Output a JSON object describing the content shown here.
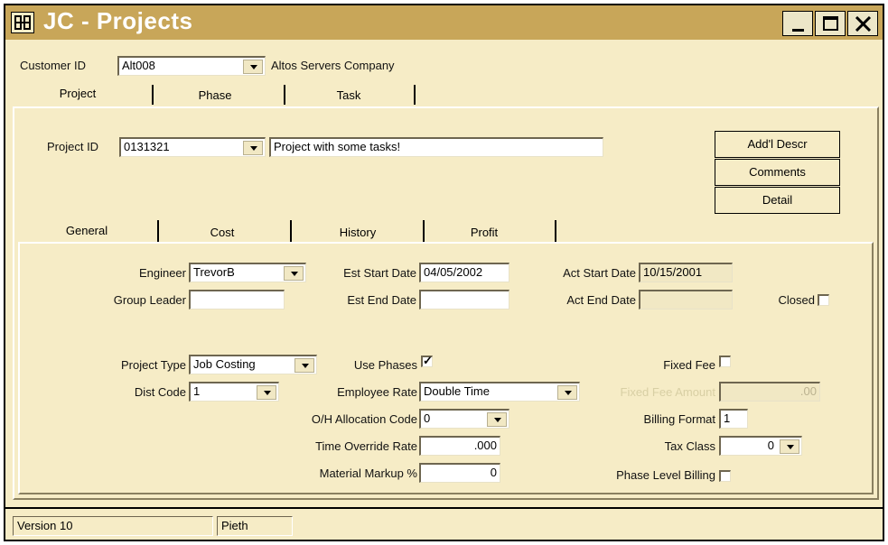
{
  "window": {
    "title": "JC - Projects",
    "minimize_label": "_",
    "maximize_label": "☐",
    "close_label": "✕"
  },
  "customer": {
    "label": "Customer ID",
    "id_value": "Alt008",
    "company_name": "Altos Servers Company"
  },
  "main_tabs": [
    "Project",
    "Phase",
    "Task"
  ],
  "project": {
    "id_label": "Project ID",
    "id_value": "0131321",
    "description": "Project with some tasks!"
  },
  "side_buttons": [
    "Add'l Descr",
    "Comments",
    "Detail"
  ],
  "sub_tabs": [
    "General",
    "Cost",
    "History",
    "Profit"
  ],
  "general": {
    "engineer_label": "Engineer",
    "engineer_value": "TrevorB",
    "group_leader_label": "Group Leader",
    "group_leader_value": "",
    "est_start_label": "Est Start Date",
    "est_start_value": "04/05/2002",
    "est_end_label": "Est End Date",
    "est_end_value": "",
    "act_start_label": "Act Start Date",
    "act_start_value": "10/15/2001",
    "act_end_label": "Act End Date",
    "act_end_value": "",
    "closed_label": "Closed",
    "closed_checked": false,
    "project_type_label": "Project Type",
    "project_type_value": "Job Costing",
    "use_phases_label": "Use Phases",
    "use_phases_checked": true,
    "fixed_fee_label": "Fixed Fee",
    "fixed_fee_checked": false,
    "dist_code_label": "Dist Code",
    "dist_code_value": "1",
    "employee_rate_label": "Employee Rate",
    "employee_rate_value": "Double Time",
    "fixed_fee_amount_label": "Fixed Fee Amount",
    "fixed_fee_amount_value": ".00",
    "oh_alloc_label": "O/H Allocation Code",
    "oh_alloc_value": "0",
    "billing_format_label": "Billing Format",
    "billing_format_value": "1",
    "time_override_label": "Time Override Rate",
    "time_override_value": ".000",
    "tax_class_label": "Tax Class",
    "tax_class_value": "0",
    "material_markup_label": "Material Markup %",
    "material_markup_value": "0",
    "phase_level_billing_label": "Phase Level Billing",
    "phase_level_billing_checked": false
  },
  "status_bar": {
    "version": "Version 10",
    "user": "Pieth"
  }
}
